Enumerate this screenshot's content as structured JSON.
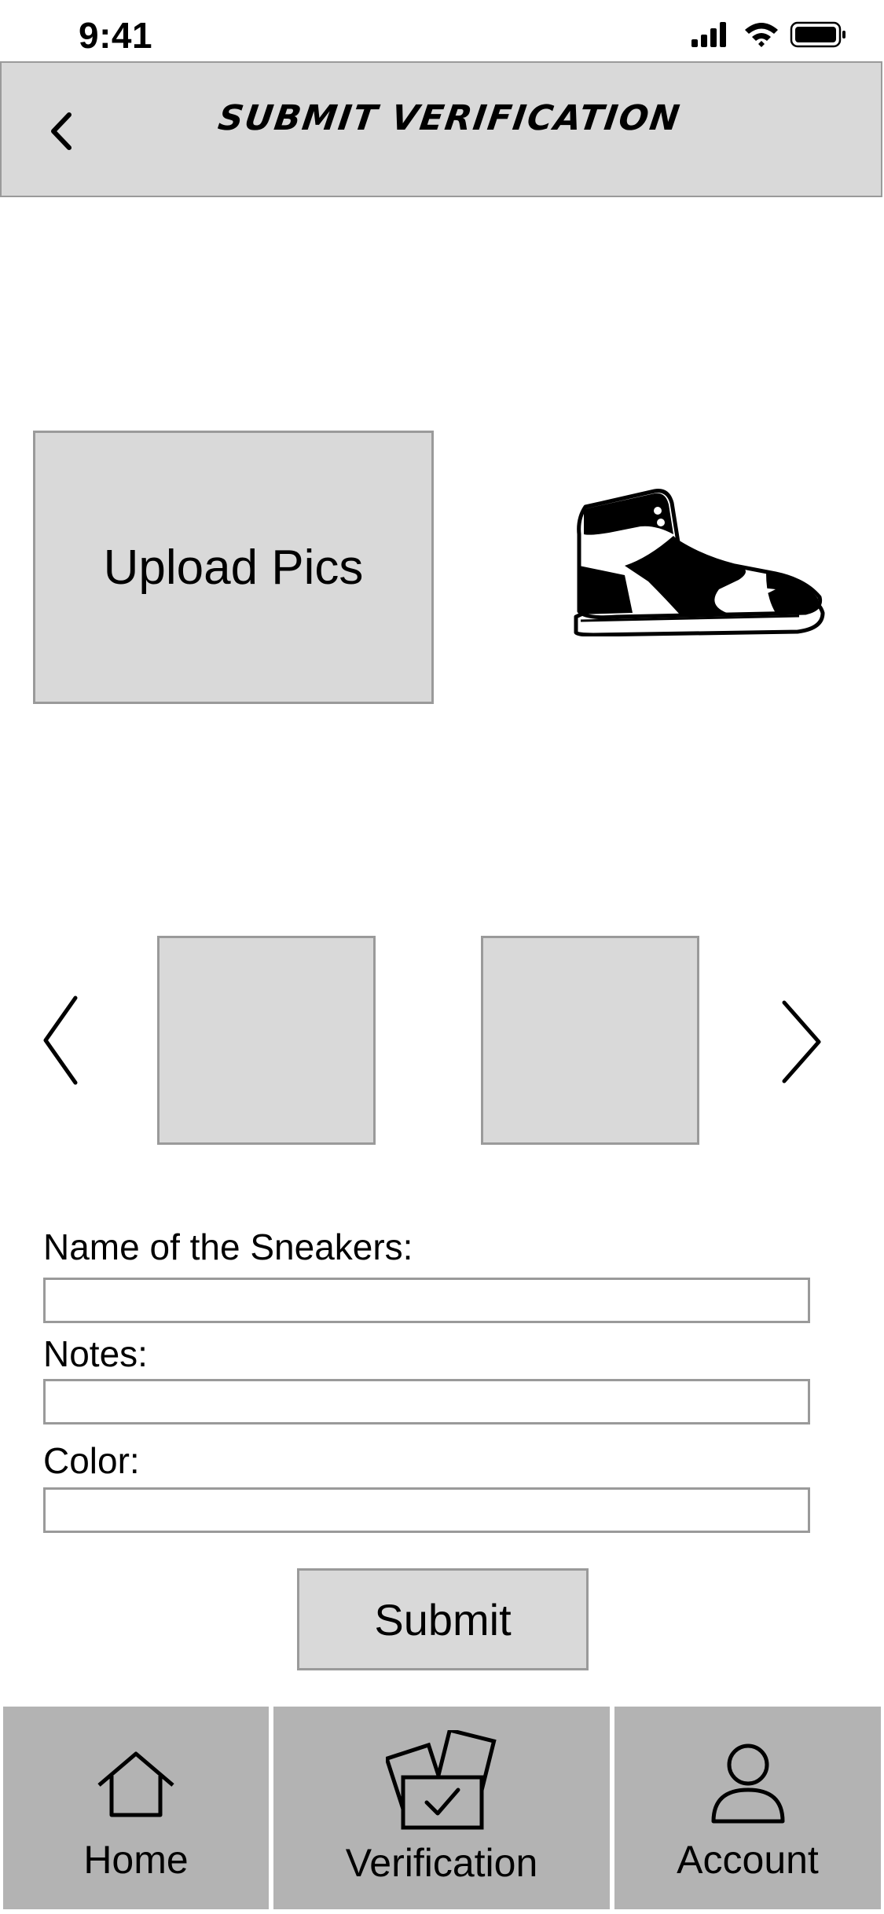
{
  "status_bar": {
    "time": "9:41"
  },
  "header": {
    "title": "SUBMIT VERIFICATION"
  },
  "upload": {
    "label": "Upload Pics"
  },
  "form": {
    "name_label": "Name of the Sneakers:",
    "notes_label": "Notes:",
    "color_label": "Color:",
    "name_value": "",
    "notes_value": "",
    "color_value": ""
  },
  "submit": {
    "label": "Submit"
  },
  "nav": {
    "items": [
      {
        "label": "Home",
        "icon": "home-icon"
      },
      {
        "label": "Verification",
        "icon": "verification-icon"
      },
      {
        "label": "Account",
        "icon": "account-icon"
      }
    ]
  },
  "icons": {
    "back": "chevron-left-icon",
    "carousel_prev": "chevron-left-icon",
    "carousel_next": "chevron-right-icon",
    "sneaker": "sneaker-image"
  }
}
